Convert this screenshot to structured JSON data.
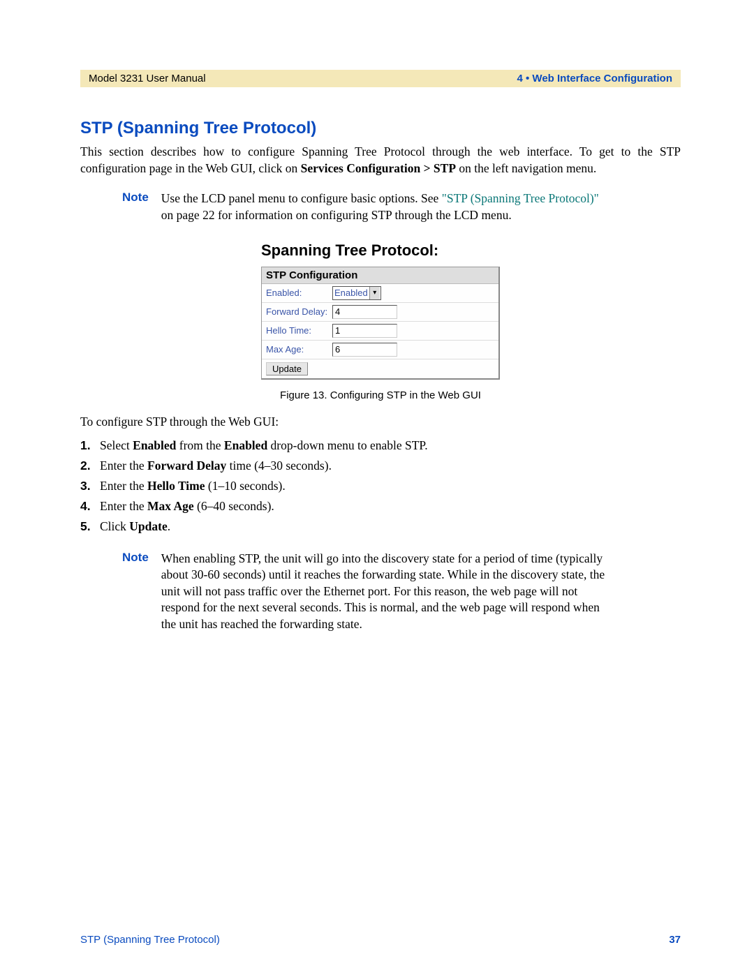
{
  "header": {
    "left": "Model 3231 User Manual",
    "right": "4 • Web Interface Configuration"
  },
  "heading": "STP (Spanning Tree Protocol)",
  "intro": {
    "pre": "This section describes how to configure Spanning Tree Protocol through the web interface. To get to the STP configuration page in the Web GUI, click on ",
    "bold1": "Services Configuration > STP",
    "post": " on the left navigation menu."
  },
  "note1": {
    "label": "Note",
    "pre": "Use the LCD panel menu to configure basic options. See ",
    "link": "\"STP (Spanning Tree Protocol)\"",
    "post": " on page 22 for information on configuring STP through the LCD menu."
  },
  "figure": {
    "title": "Spanning Tree Protocol:",
    "panel_header": "STP Configuration",
    "rows": [
      {
        "label": "Enabled:",
        "type": "select",
        "value": "Enabled"
      },
      {
        "label": "Forward Delay:",
        "type": "input",
        "value": "4"
      },
      {
        "label": "Hello Time:",
        "type": "input",
        "value": "1"
      },
      {
        "label": "Max Age:",
        "type": "input",
        "value": "6"
      }
    ],
    "button": "Update",
    "caption": "Figure 13. Configuring STP in the Web GUI"
  },
  "lead_in": "To configure STP through the Web GUI:",
  "steps": {
    "s1_a": "Select ",
    "s1_b": "Enabled",
    "s1_c": " from the ",
    "s1_d": "Enabled",
    "s1_e": " drop-down menu to enable STP.",
    "s2_a": "Enter the ",
    "s2_b": "Forward Delay",
    "s2_c": " time (4–30 seconds).",
    "s3_a": "Enter the ",
    "s3_b": "Hello Time",
    "s3_c": " (1–10 seconds).",
    "s4_a": "Enter the ",
    "s4_b": "Max Age",
    "s4_c": " (6–40 seconds).",
    "s5_a": "Click ",
    "s5_b": "Update",
    "s5_c": "."
  },
  "note2": {
    "label": "Note",
    "text": "When enabling STP, the unit will go into the discovery state for a period of time (typically about 30-60 seconds) until it reaches the forwarding state. While in the discovery state, the unit will not pass traffic over the Ethernet port. For this reason, the web page will not respond for the next several seconds. This is normal, and the web page will respond when the unit has reached the forwarding state."
  },
  "footer": {
    "left": "STP (Spanning Tree Protocol)",
    "right": "37"
  }
}
